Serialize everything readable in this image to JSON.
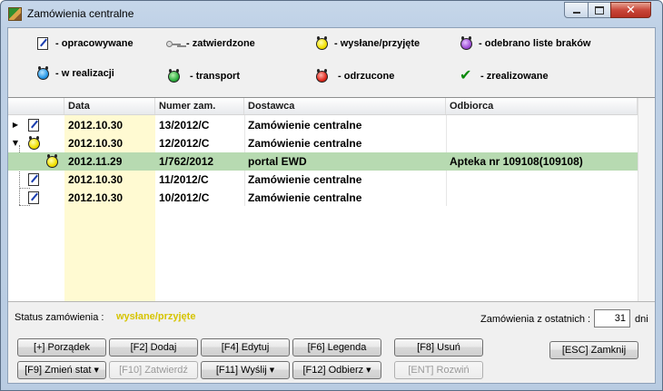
{
  "window": {
    "title": "Zamówienia centralne"
  },
  "legend": [
    {
      "icon": "pen-icon",
      "label": "- opracowywane"
    },
    {
      "icon": "key-icon",
      "label": "- zatwierdzone"
    },
    {
      "icon": "yellow-alarm-ball-icon",
      "label": "- wysłane/przyjęte"
    },
    {
      "icon": "purple-alarm-ball-icon",
      "label": "- odebrano liste braków"
    },
    {
      "icon": "blue-alarm-ball-icon",
      "label": "- w realizacji"
    },
    {
      "icon": "green-alarm-ball-icon",
      "label": "- transport"
    },
    {
      "icon": "red-alarm-ball-icon",
      "label": "- odrzucone"
    },
    {
      "icon": "green-check-icon",
      "label": "- zrealizowane"
    }
  ],
  "grid": {
    "columns": [
      "Data",
      "Numer zam.",
      "Dostawca",
      "Odbiorca"
    ],
    "rows": [
      {
        "expander": "collapsed",
        "icon": "pen-icon",
        "data": "2012.10.30",
        "numer": "13/2012/C",
        "dostawca": "Zamówienie centralne",
        "odbiorca": ""
      },
      {
        "expander": "expanded",
        "icon": "yellow-alarm-ball-icon",
        "data": "2012.10.30",
        "numer": "12/2012/C",
        "dostawca": "Zamówienie centralne",
        "odbiorca": ""
      },
      {
        "expander": "child",
        "icon": "yellow-alarm-ball-icon",
        "data": "2012.11.29",
        "numer": "1/762/2012",
        "dostawca": "portal EWD",
        "odbiorca": "Apteka nr 109108(109108)",
        "selected": true
      },
      {
        "expander": "none",
        "icon": "pen-icon",
        "data": "2012.10.30",
        "numer": "11/2012/C",
        "dostawca": "Zamówienie centralne",
        "odbiorca": ""
      },
      {
        "expander": "none",
        "icon": "pen-icon",
        "data": "2012.10.30",
        "numer": "10/2012/C",
        "dostawca": "Zamówienie centralne",
        "odbiorca": ""
      }
    ]
  },
  "status": {
    "label": "Status zamówienia :",
    "value": "wysłane/przyjęte",
    "days_label": "Zamówienia z ostatnich :",
    "days_value": "31",
    "days_suffix": "dni"
  },
  "buttons": {
    "porzadek": "[+] Porządek",
    "dodaj": "[F2] Dodaj",
    "edytuj": "[F4] Edytuj",
    "legenda": "[F6] Legenda",
    "usun": "[F8] Usuń",
    "zamknij": "[ESC] Zamknij",
    "zmien_stat": "[F9] Zmień stat",
    "zatwierdz": "[F10] Zatwierdź",
    "wyslij": "[F11] Wyślij",
    "odbierz": "[F12] Odbierz",
    "rozwin": "[ENT] Rozwiń"
  },
  "colors": {
    "selected_row": "#b7dab1",
    "date_column": "#fffad2",
    "status_value": "#d6c400"
  }
}
